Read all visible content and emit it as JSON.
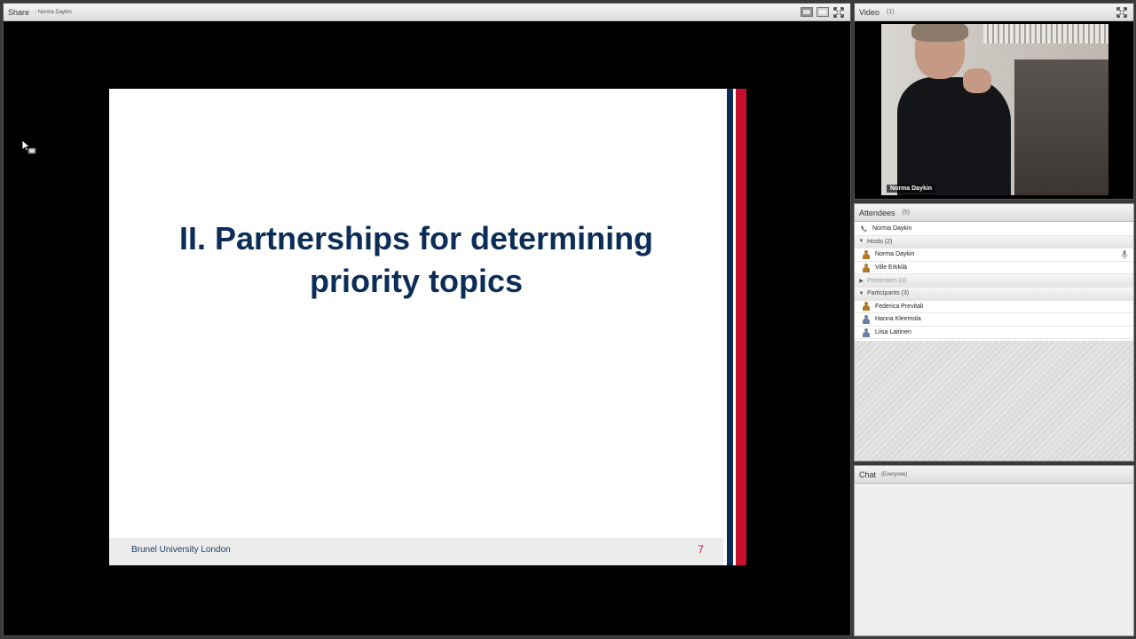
{
  "share": {
    "title": "Share",
    "presenter": "- Norma Daykin"
  },
  "slide": {
    "title_line1": "II. Partnerships for determining",
    "title_line2": "priority topics",
    "footer_text": "Brunel University London",
    "page_number": "7",
    "colors": {
      "title": "#0c2d57",
      "stripe": [
        "#0c2d57",
        "#ffffff",
        "#c8102e"
      ]
    }
  },
  "video": {
    "title": "Video",
    "count": "(1)",
    "name_label": "Norma Daykin"
  },
  "attendees": {
    "title": "Attendees",
    "count": "(5)",
    "self": "Norma Daykin",
    "hosts_label": "Hosts (2)",
    "hosts": [
      "Norma Daykin",
      "Ville Erkkilä"
    ],
    "presenters_label": "Presenters (0)",
    "participants_label": "Participants (3)",
    "participants": [
      "Federica Previtali",
      "Hanna Kleemola",
      "Liisa Laitinen"
    ]
  },
  "chat": {
    "title": "Chat",
    "scope": "(Everyone)"
  }
}
